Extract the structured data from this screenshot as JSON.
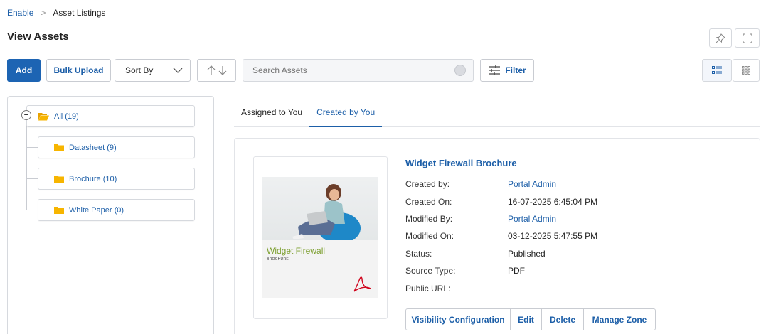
{
  "breadcrumb": {
    "root": "Enable",
    "separator": ">",
    "current": "Asset Listings"
  },
  "page": {
    "title": "View Assets"
  },
  "toolbar": {
    "add_label": "Add",
    "bulk_upload_label": "Bulk Upload",
    "sort_by_label": "Sort By",
    "search_placeholder": "Search Assets",
    "filter_label": "Filter"
  },
  "tree": {
    "root": {
      "label": "All (19)",
      "collapse_symbol": "−"
    },
    "children": [
      {
        "label": "Datasheet (9)"
      },
      {
        "label": "Brochure (10)"
      },
      {
        "label": "White Paper (0)"
      }
    ]
  },
  "tabs": [
    {
      "label": "Assigned to You",
      "active": false
    },
    {
      "label": "Created by You",
      "active": true
    }
  ],
  "asset": {
    "title": "Widget Firewall Brochure",
    "thumbnail": {
      "title": "Widget Firewall",
      "subtitle": "BROCHURE"
    },
    "fields": [
      {
        "label": "Created by:",
        "value": "Portal Admin",
        "link": true
      },
      {
        "label": "Created On:",
        "value": "16-07-2025 6:45:04 PM",
        "link": false
      },
      {
        "label": "Modified By:",
        "value": "Portal Admin",
        "link": true
      },
      {
        "label": "Modified On:",
        "value": "03-12-2025 5:47:55 PM",
        "link": false
      },
      {
        "label": "Status:",
        "value": "Published",
        "link": false
      },
      {
        "label": "Source Type:",
        "value": "PDF",
        "link": false
      },
      {
        "label": "Public URL:",
        "value": "",
        "link": false
      }
    ],
    "actions": [
      {
        "label": "Visibility Configuration"
      },
      {
        "label": "Edit"
      },
      {
        "label": "Delete"
      },
      {
        "label": "Manage Zone"
      }
    ]
  },
  "colors": {
    "accent": "#1d64b3",
    "link": "#1d5fa8",
    "folder": "#f7b500",
    "thumb_title": "#7ea032",
    "pdf_icon": "#d0021b"
  },
  "icons": [
    "pin-icon",
    "fullscreen-icon",
    "chevron-down-icon",
    "sort-arrows-icon",
    "search-icon",
    "filter-sliders-icon",
    "list-view-icon",
    "grid-view-icon",
    "folder-open-icon",
    "folder-icon",
    "pdf-icon"
  ]
}
